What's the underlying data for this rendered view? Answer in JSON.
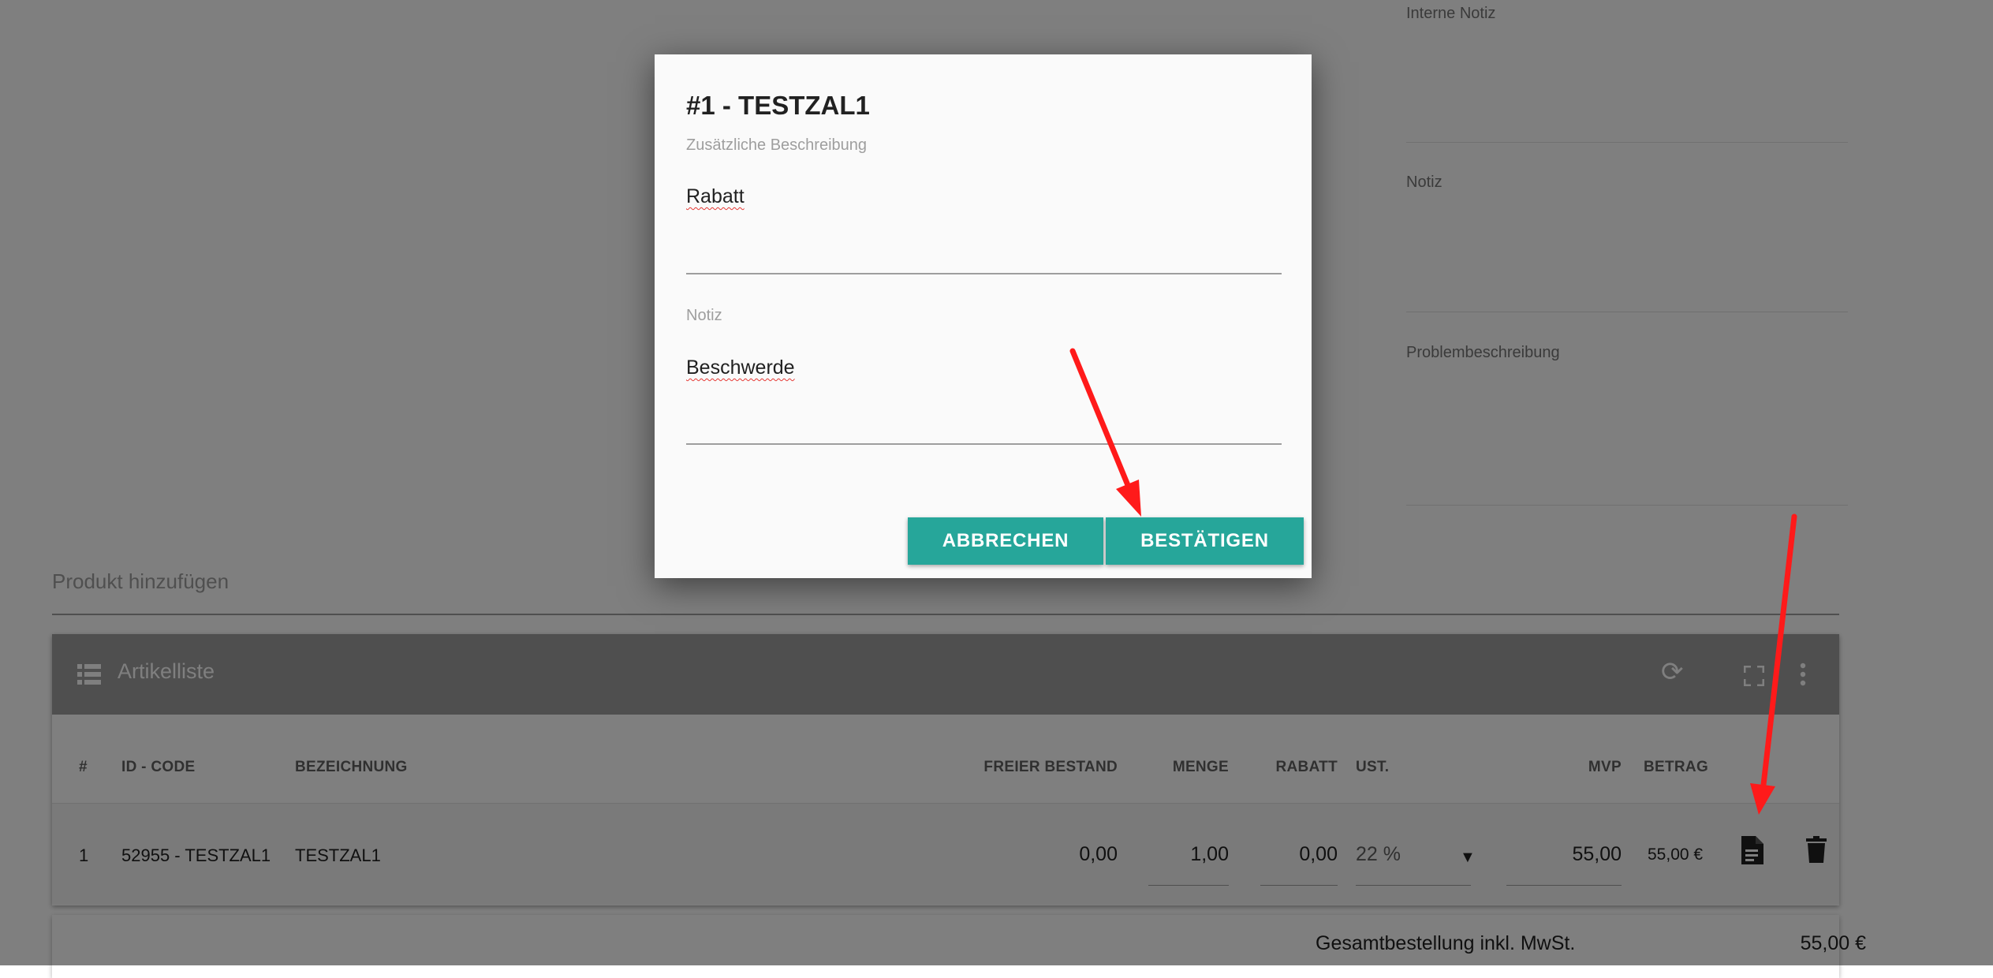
{
  "side_fields": {
    "internal_note_label": "Interne Notiz",
    "note_label": "Notiz",
    "problem_label": "Problembeschreibung"
  },
  "add_product": {
    "placeholder": "Produkt hinzufügen"
  },
  "article_list": {
    "title": "Artikelliste",
    "columns": [
      "#",
      "ID - CODE",
      "BEZEICHNUNG",
      "FREIER BESTAND",
      "MENGE",
      "RABATT",
      "UST.",
      "MVP",
      "BETRAG"
    ],
    "rows": [
      {
        "index": "1",
        "id_code": "52955 - TESTZAL1",
        "name": "TESTZAL1",
        "free_stock": "0,00",
        "quantity": "1,00",
        "discount": "0,00",
        "vat": "22 %",
        "mvp": "55,00",
        "amount": "55,00 €"
      }
    ]
  },
  "total": {
    "label": "Gesamtbestellung inkl. MwSt.",
    "value": "55,00 €"
  },
  "dialog": {
    "title": "#1 - TESTZAL1",
    "description_label": "Zusätzliche Beschreibung",
    "description_value": "Rabatt",
    "note_label": "Notiz",
    "note_value": "Beschwerde",
    "cancel_label": "ABBRECHEN",
    "confirm_label": "BESTÄTIGEN"
  },
  "colors": {
    "accent": "#26a69a",
    "annotation_arrow": "#ff1a1a"
  }
}
